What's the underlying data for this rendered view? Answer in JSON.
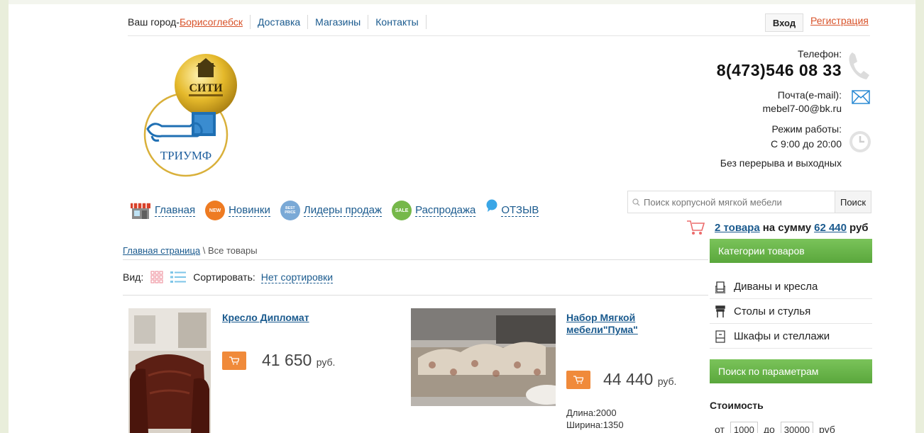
{
  "topnav": {
    "city_label": "Ваш город-",
    "city_value": "Борисоглебск",
    "links": [
      "Доставка",
      "Магазины",
      "Контакты"
    ],
    "login": "Вход",
    "register": "Регистрация"
  },
  "logo": {
    "top_text": "СИТИ",
    "bottom_text": "ТРИУМФ"
  },
  "contacts": {
    "phone_label": "Телефон:",
    "phone": "8(473)546 08 33",
    "email_label": "Почта(e-mail):",
    "email": "mebel7-00@bk.ru",
    "hours_label": "Режим работы:",
    "hours": "С 9:00 до 20:00",
    "hours_note": "Без перерыва и выходных"
  },
  "menu": {
    "items": [
      {
        "label": "Главная",
        "icon": "shop-icon"
      },
      {
        "label": "Новинки",
        "icon": "new-badge-icon",
        "badge": "NEW"
      },
      {
        "label": "Лидеры продаж",
        "icon": "best-price-icon",
        "badge": "BEST PRICE"
      },
      {
        "label": "Распродажа",
        "icon": "sale-badge-icon",
        "badge": "SALE"
      },
      {
        "label": "ОТЗЫВ",
        "icon": "speech-bubble-icon"
      }
    ]
  },
  "search": {
    "placeholder": "Поиск корпусной мягкой мебели",
    "button": "Поиск"
  },
  "cart": {
    "count_text": "2 товара",
    "middle": "на сумму",
    "amount": "62 440",
    "currency": "руб"
  },
  "breadcrumb": {
    "home": "Главная страница",
    "sep": " \\ ",
    "current": "Все товары"
  },
  "viewbar": {
    "view_label": "Вид:",
    "sort_label": "Сортировать:",
    "sort_value": "Нет сортировки"
  },
  "products": [
    {
      "title": "Кресло Дипломат",
      "price": "41 650",
      "currency": "руб."
    },
    {
      "title_line1": "Набор Мягкой",
      "title_line2": "мебели\"Пума\"",
      "price": "44 440",
      "currency": "руб.",
      "spec1": "Длина:2000",
      "spec2": "Ширина:1350"
    }
  ],
  "sidebar": {
    "categories_title": "Категории товаров",
    "categories": [
      {
        "label": "Диваны и кресла",
        "icon": "armchair-icon"
      },
      {
        "label": "Столы и стулья",
        "icon": "chair-icon"
      },
      {
        "label": "Шкафы и стеллажи",
        "icon": "wardrobe-icon"
      }
    ],
    "params_title": "Поиск по параметрам",
    "cost_title": "Стоимость",
    "from_label": "от",
    "from_value": "1000",
    "to_label": "до",
    "to_value": "30000",
    "range_currency": "руб"
  },
  "colors": {
    "link": "#1a5a8e",
    "accent": "#d8532a",
    "green": "#5aa73c",
    "orange": "#f08a3a"
  }
}
